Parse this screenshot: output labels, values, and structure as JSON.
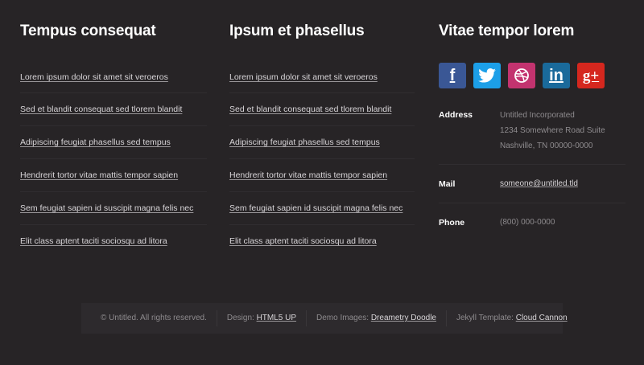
{
  "columns": [
    {
      "title": "Tempus consequat",
      "links": [
        "Lorem ipsum dolor sit amet sit veroeros",
        "Sed et blandit consequat sed tlorem blandit",
        "Adipiscing feugiat phasellus sed tempus",
        "Hendrerit tortor vitae mattis tempor sapien",
        "Sem feugiat sapien id suscipit magna felis nec",
        "Elit class aptent taciti sociosqu ad litora"
      ]
    },
    {
      "title": "Ipsum et phasellus",
      "links": [
        "Lorem ipsum dolor sit amet sit veroeros",
        "Sed et blandit consequat sed tlorem blandit",
        "Adipiscing feugiat phasellus sed tempus",
        "Hendrerit tortor vitae mattis tempor sapien",
        "Sem feugiat sapien id suscipit magna felis nec",
        "Elit class aptent taciti sociosqu ad litora"
      ]
    }
  ],
  "contact_col": {
    "title": "Vitae tempor lorem",
    "social": [
      {
        "name": "facebook-icon",
        "glyph": "f",
        "color": "#3a5795"
      },
      {
        "name": "twitter-icon",
        "glyph": "",
        "color": "#1c9fe8"
      },
      {
        "name": "dribbble-icon",
        "glyph": "",
        "color": "#c3336f"
      },
      {
        "name": "linkedin-icon",
        "glyph": "in",
        "color": "#1a6a9b"
      },
      {
        "name": "google-plus-icon",
        "glyph": "g+",
        "color": "#d5271e"
      }
    ],
    "address": {
      "label": "Address",
      "line1": "Untitled Incorporated",
      "line2": "1234 Somewhere Road Suite",
      "line3": "Nashville, TN 00000-0000"
    },
    "mail": {
      "label": "Mail",
      "value": "someone@untitled.tld"
    },
    "phone": {
      "label": "Phone",
      "value": "(800) 000-0000"
    }
  },
  "footer": {
    "copyright": "© Untitled. All rights reserved.",
    "design_label": "Design:",
    "design_link": "HTML5 UP",
    "demo_label": "Demo Images:",
    "demo_link": "Dreametry Doodle",
    "jekyll_label": "Jekyll Template:",
    "jekyll_link": "Cloud Cannon"
  }
}
